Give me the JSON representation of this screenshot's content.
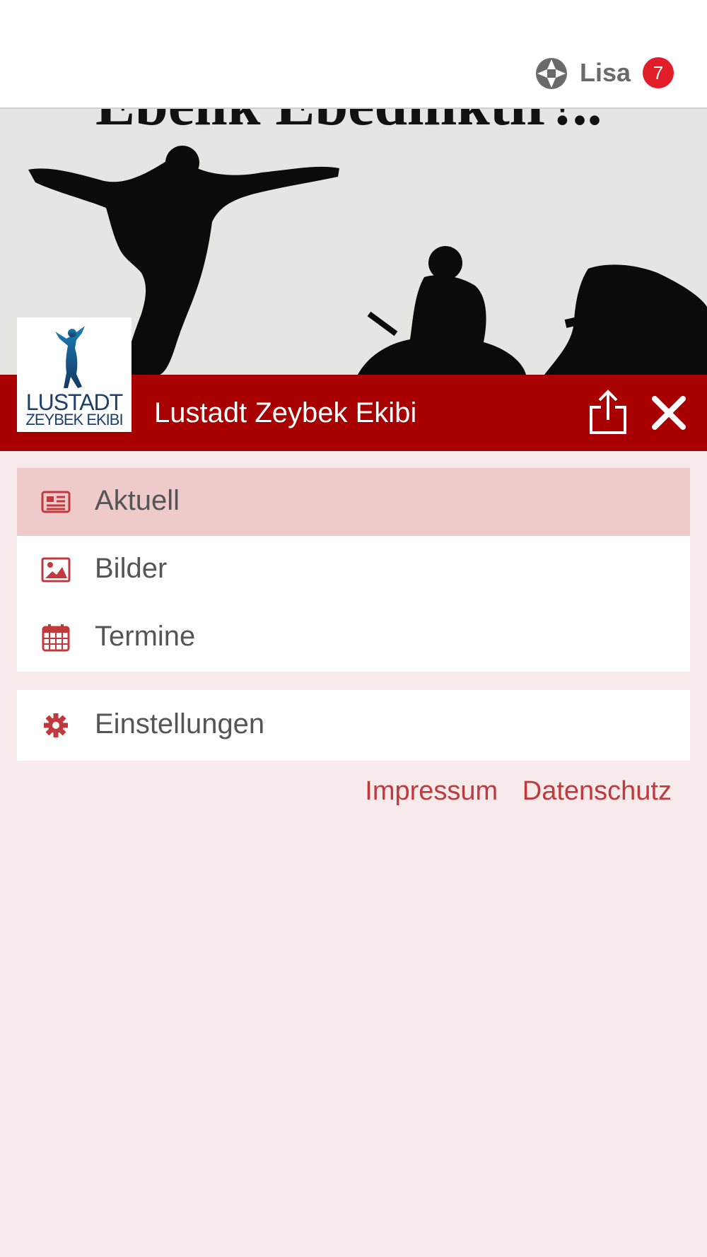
{
  "topbar": {
    "user_name": "Lisa",
    "notification_count": "7",
    "icons": [
      "app-logo-icon"
    ]
  },
  "hero": {
    "banner_text_partial": "Ebelik Ebediliktir!..",
    "logo_text_line1": "LUSTADT",
    "logo_text_line2": "ZEYBEK EKIBI"
  },
  "header": {
    "title": "Lustadt Zeybek Ekibi",
    "icons": [
      "share-icon",
      "close-icon"
    ]
  },
  "menu": {
    "items": [
      {
        "label": "Aktuell",
        "icon": "newspaper-icon",
        "active": true
      },
      {
        "label": "Bilder",
        "icon": "image-icon",
        "active": false
      },
      {
        "label": "Termine",
        "icon": "calendar-icon",
        "active": false
      }
    ],
    "settings": {
      "label": "Einstellungen",
      "icon": "gear-icon"
    }
  },
  "footer_links": {
    "impressum": "Impressum",
    "datenschutz": "Datenschutz"
  },
  "colors": {
    "header_red": "#a80000",
    "active_bg": "#eecacb",
    "page_bg": "#f6eaeb",
    "icon_red": "#c0393d",
    "badge_red": "#e11d2a"
  }
}
